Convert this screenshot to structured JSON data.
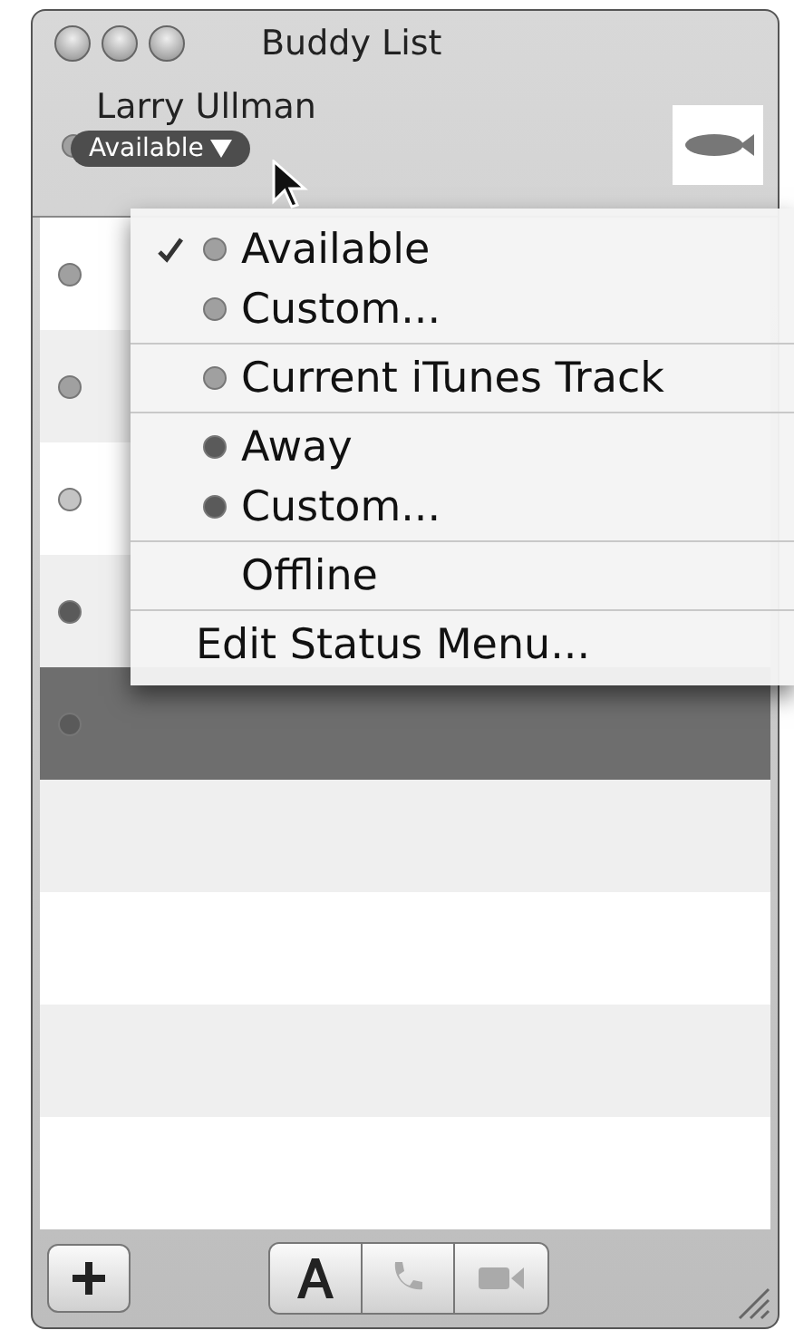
{
  "window": {
    "title": "Buddy List"
  },
  "account": {
    "name": "Larry Ullman",
    "status": "Available"
  },
  "buddies": [
    {
      "kind": "available",
      "selected": false
    },
    {
      "kind": "available",
      "selected": false
    },
    {
      "kind": "idle",
      "selected": false
    },
    {
      "kind": "away",
      "selected": false
    },
    {
      "kind": "away",
      "selected": true
    }
  ],
  "status_menu": {
    "groups": [
      [
        {
          "kind": "available",
          "label": "Available",
          "checked": true
        },
        {
          "kind": "available",
          "label": "Custom...",
          "checked": false
        }
      ],
      [
        {
          "kind": "available",
          "label": "Current iTunes Track",
          "checked": false
        }
      ],
      [
        {
          "kind": "away",
          "label": "Away",
          "checked": false
        },
        {
          "kind": "away",
          "label": "Custom...",
          "checked": false
        }
      ],
      [
        {
          "kind": "none",
          "label": "Offline",
          "checked": false
        }
      ],
      [
        {
          "kind": "command",
          "label": "Edit Status Menu..."
        }
      ]
    ]
  }
}
